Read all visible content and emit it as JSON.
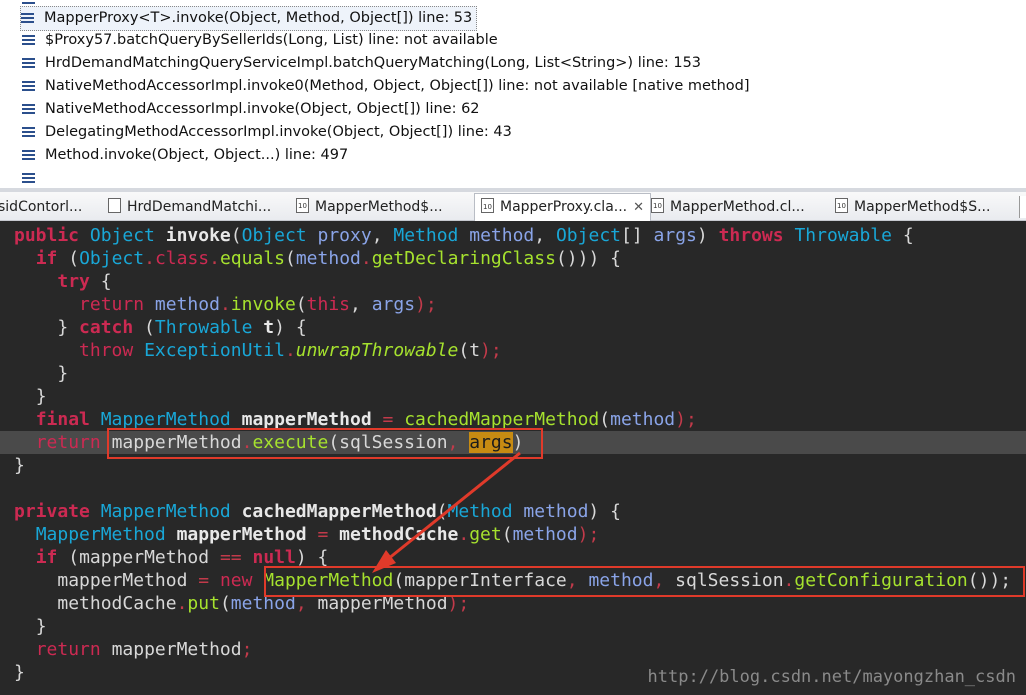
{
  "stack_trace": {
    "frames": [
      "MapperProxy<T>.invoke(Object, Method, Object[]) line: 53",
      "$Proxy57.batchQueryBySellerIds(Long, List) line: not available",
      "HrdDemandMatchingQueryServiceImpl.batchQueryMatching(Long, List<String>) line: 153",
      "NativeMethodAccessorImpl.invoke0(Method, Object, Object[]) line: not available [native method]",
      "NativeMethodAccessorImpl.invoke(Object, Object[]) line: 62",
      "DelegatingMethodAccessorImpl.invoke(Object, Object[]) line: 43",
      "Method.invoke(Object, Object...) line: 497"
    ]
  },
  "tabs": [
    {
      "label": "sidContorl..."
    },
    {
      "label": "HrdDemandMatchi..."
    },
    {
      "label": "MapperMethod$..."
    },
    {
      "label": "MapperProxy.cla..."
    },
    {
      "label": "MapperMethod.cl..."
    },
    {
      "label": "MapperMethod$S..."
    }
  ],
  "active_tab_index": 3,
  "code": {
    "l1": {
      "kw1": "public",
      "t1": "Object",
      "name": "invoke",
      "t2": "Object",
      "p1": "proxy",
      "t3": "Method",
      "p2": "method",
      "t4": "Object",
      "br": "[]",
      "p3": "args",
      "kw2": "throws",
      "t5": "Throwable",
      "open": "{"
    },
    "l2": {
      "kw": "if",
      "t": "Object",
      "cls": "class",
      "eq": "equals",
      "p": "method",
      "get": "getDeclaringClass",
      "tail": "())) {"
    },
    "l3": {
      "kw": "try",
      "open": "{"
    },
    "l4": {
      "kw": "return",
      "p": "method",
      "call": "invoke",
      "self": "this",
      "a": "args",
      "end": ");"
    },
    "l5": {
      "kw": "catch",
      "t": "Throwable",
      "v": "t",
      "tail": ") {"
    },
    "l6": {
      "kw": "throw",
      "t": "ExceptionUtil",
      "call": "unwrapThrowable",
      "v": "t",
      "end": ");"
    },
    "l7": "}",
    "l8": "}",
    "l9": {
      "kw": "final",
      "t": "MapperMethod",
      "v": "mapperMethod",
      "eq": "=",
      "call": "cachedMapperMethod",
      "p": "method",
      "end": ");"
    },
    "l10": {
      "kw": "return",
      "v": "mapperMethod",
      "call": "execute",
      "s": "sqlSession",
      "a": "args",
      "end": ")"
    },
    "l11": "}",
    "l13": {
      "kw": "private",
      "t": "MapperMethod",
      "name": "cachedMapperMethod",
      "t2": "Method",
      "p": "method",
      "tail": ") {"
    },
    "l14": {
      "t": "MapperMethod",
      "v": "mapperMethod",
      "eq": "=",
      "cache": "methodCache",
      "call": "get",
      "p": "method",
      "end": ");"
    },
    "l15": {
      "kw": "if",
      "v": "mapperMethod",
      "op": "==",
      "nul": "null",
      "tail": ") {"
    },
    "l16": {
      "v": "mapperMethod",
      "eq": "=",
      "kw": "new",
      "t": "MapperMethod",
      "iface": "mapperInterface",
      "p": "method",
      "s": "sqlSession",
      "call": "getConfiguration",
      "end": "());"
    },
    "l17": {
      "cache": "methodCache",
      "call": "put",
      "p": "method",
      "v": "mapperMethod",
      "end": ");"
    },
    "l18": "}",
    "l19": {
      "kw": "return",
      "v": "mapperMethod",
      "end": ";"
    },
    "l20": "}"
  },
  "watermark": "http://blog.csdn.net/mayongzhan_csdn",
  "colors": {
    "annotation": "#e03a2a",
    "current_line": "#4a4a4a",
    "editor_bg": "#282828"
  }
}
